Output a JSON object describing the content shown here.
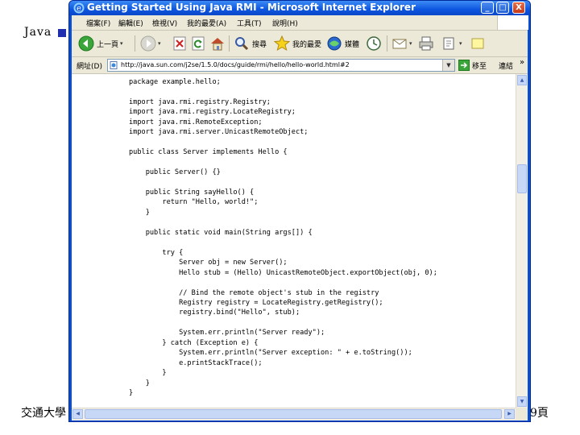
{
  "slide": {
    "header_text": "Java",
    "footer_left": "交通大學",
    "footer_right": "9頁",
    "bullet_color": "#1f2fb0"
  },
  "window": {
    "title": "Getting Started Using Java RMI - Microsoft Internet Explorer",
    "controls": {
      "minimize": "_",
      "maximize": "□",
      "close": "X"
    }
  },
  "menu": [
    "檔案(F)",
    "編輯(E)",
    "檢視(V)",
    "我的最愛(A)",
    "工具(T)",
    "說明(H)"
  ],
  "toolbar": {
    "back": "上一頁",
    "search": "搜尋",
    "favorites": "我的最愛",
    "media": "媒體"
  },
  "address": {
    "label": "網址(D)",
    "url": "http://java.sun.com/j2se/1.5.0/docs/guide/rmi/hello/hello-world.html#2",
    "go": "移至",
    "links": "連結",
    "links_chevron": "»"
  },
  "code_lines": [
    "package example.hello;",
    "",
    "import java.rmi.registry.Registry;",
    "import java.rmi.registry.LocateRegistry;",
    "import java.rmi.RemoteException;",
    "import java.rmi.server.UnicastRemoteObject;",
    "",
    "public class Server implements Hello {",
    "",
    "    public Server() {}",
    "",
    "    public String sayHello() {",
    "        return \"Hello, world!\";",
    "    }",
    "",
    "    public static void main(String args[]) {",
    "",
    "        try {",
    "            Server obj = new Server();",
    "            Hello stub = (Hello) UnicastRemoteObject.exportObject(obj, 0);",
    "",
    "            // Bind the remote object's stub in the registry",
    "            Registry registry = LocateRegistry.getRegistry();",
    "            registry.bind(\"Hello\", stub);",
    "",
    "            System.err.println(\"Server ready\");",
    "        } catch (Exception e) {",
    "            System.err.println(\"Server exception: \" + e.toString());",
    "            e.printStackTrace();",
    "        }",
    "    }",
    "}"
  ]
}
